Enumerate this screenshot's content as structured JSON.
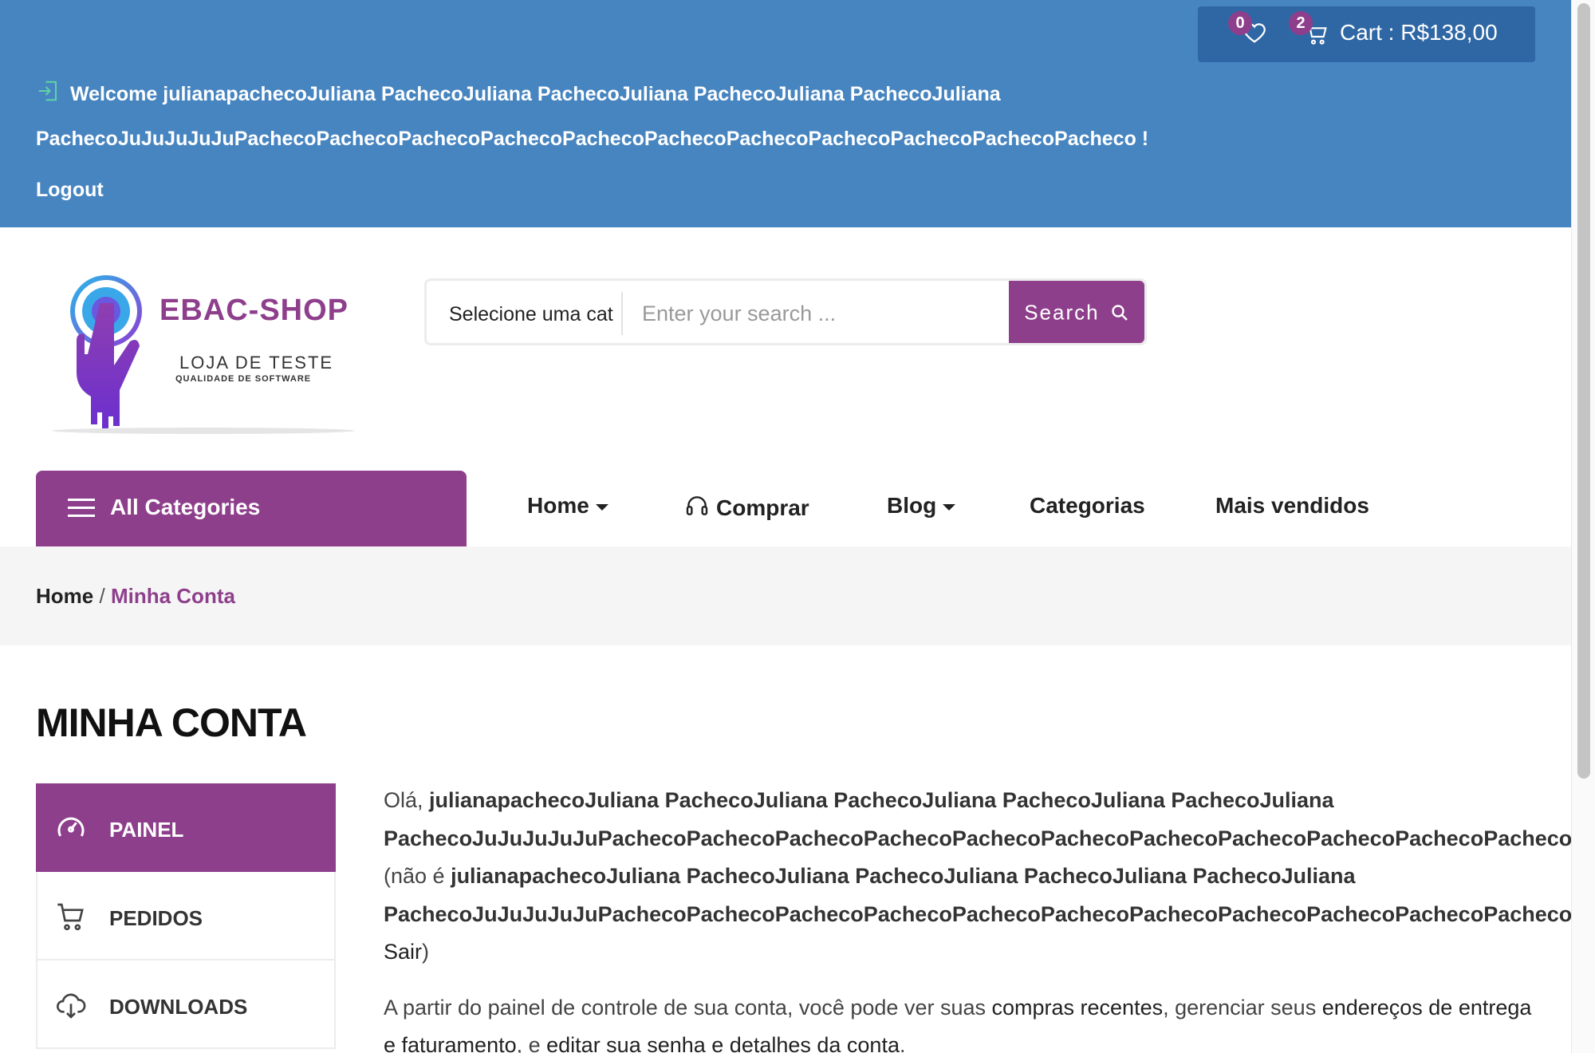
{
  "topbar": {
    "wishlist_count": "0",
    "cart_count": "2",
    "cart_label": "Cart : R$138,00",
    "welcome": "Welcome julianapachecoJuliana PachecoJuliana PachecoJuliana PachecoJuliana PachecoJuliana PachecoJuJuJuJuJuPachecoPachecoPachecoPachecoPachecoPachecoPachecoPachecoPachecoPachecoPacheco !",
    "logout": "Logout"
  },
  "logo": {
    "title": "EBAC-SHOP",
    "subtitle": "LOJA DE TESTE",
    "tagline": "QUALIDADE DE SOFTWARE"
  },
  "search": {
    "category": "Selecione uma cat",
    "placeholder": "Enter your search ...",
    "button": "Search"
  },
  "nav": {
    "all_categories": "All Categories",
    "items": [
      "Home",
      "Comprar",
      "Blog",
      "Categorias",
      "Mais vendidos"
    ]
  },
  "breadcrumb": {
    "home": "Home",
    "separator": "/",
    "current": "Minha Conta"
  },
  "page_title": "MINHA CONTA",
  "account_menu": [
    "PAINEL",
    "PEDIDOS",
    "DOWNLOADS"
  ],
  "content": {
    "hello_prefix": "Olá, ",
    "user": "julianapachecoJuliana PachecoJuliana PachecoJuliana PachecoJuliana PachecoJuliana PachecoJuJuJuJuJuPachecoPachecoPachecoPachecoPachecoPachecoPachecoPachecoPachecoPachecoPacheco",
    "not_prefix": " (não é ",
    "not_suffix": "? ",
    "sair": "Sair",
    "close_paren": ")",
    "p2_a": "A partir do painel de controle de sua conta, você pode ver suas ",
    "p2_link1": "compras recentes",
    "p2_b": ", gerenciar seus ",
    "p2_link2": "endereços de entrega e faturamento",
    "p2_c": ", e ",
    "p2_link3": "editar sua senha e detalhes da conta",
    "p2_d": "."
  },
  "colors": {
    "topbar": "#4785c1",
    "cartbox": "#2f67a5",
    "accent": "#8e3f8c",
    "band": "#f5f5f5"
  }
}
